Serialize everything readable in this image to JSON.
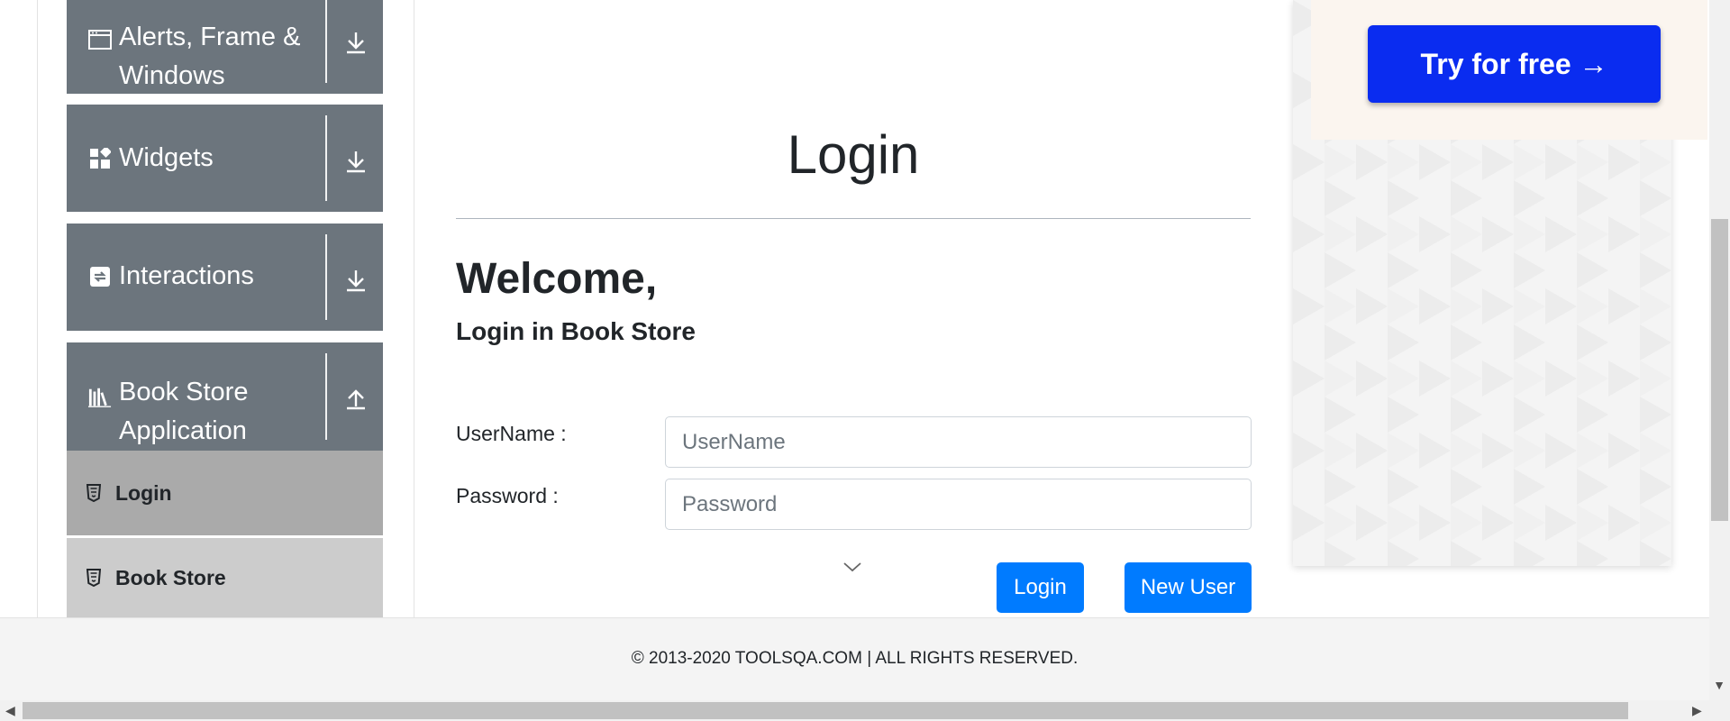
{
  "sidebar": {
    "groups": [
      {
        "label_line1": "Alerts, Frame &",
        "label_line2": "Windows",
        "icon": "window-icon",
        "toggle": "download-arrow-icon"
      },
      {
        "label": "Widgets",
        "icon": "widgets-icon",
        "toggle": "download-arrow-icon"
      },
      {
        "label": "Interactions",
        "icon": "interactions-icon",
        "toggle": "download-arrow-icon"
      },
      {
        "label_line1": "Book Store",
        "label_line2": "Application",
        "icon": "books-icon",
        "toggle": "upload-arrow-icon"
      }
    ],
    "items": [
      {
        "label": "Login",
        "active": true
      },
      {
        "label": "Book Store",
        "active": false
      }
    ]
  },
  "main": {
    "title": "Login",
    "welcome": "Welcome,",
    "subtitle": "Login in Book Store",
    "username_label": "UserName :",
    "username_placeholder": "UserName",
    "password_label": "Password :",
    "password_placeholder": "Password",
    "login_button": "Login",
    "new_user_button": "New User"
  },
  "ad": {
    "button_label": "Try for free →"
  },
  "footer": {
    "text": "© 2013-2020 TOOLSQA.COM | ALL RIGHTS RESERVED."
  },
  "colors": {
    "sidebar_header": "#6c757d",
    "active_item": "#aaaaaa",
    "inactive_item": "#cccccc",
    "primary": "#007bff",
    "ad_button": "#0a2cf0"
  }
}
